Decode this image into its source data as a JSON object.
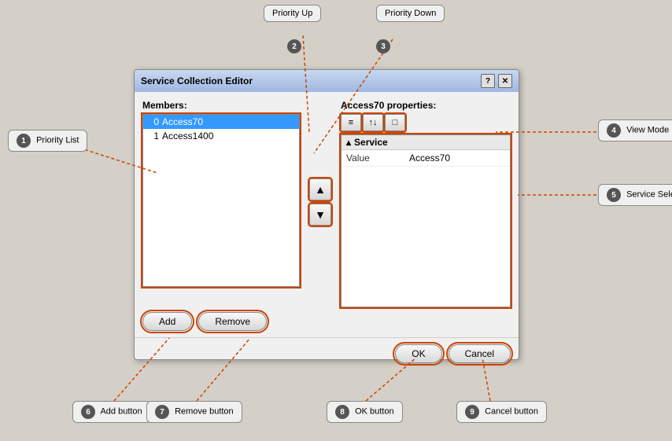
{
  "dialog": {
    "title": "Service Collection Editor",
    "members_label": "Members:",
    "properties_label": "Access70 properties:",
    "members": [
      {
        "index": 0,
        "name": "Access70",
        "selected": true
      },
      {
        "index": 1,
        "name": "Access1400",
        "selected": false
      }
    ],
    "properties": {
      "section": "Service",
      "rows": [
        {
          "name": "Value",
          "value": "Access70"
        }
      ]
    },
    "view_buttons": [
      "≡",
      "↑↓",
      "□"
    ],
    "priority_up_icon": "▲",
    "priority_down_icon": "▼",
    "add_label": "Add",
    "remove_label": "Remove",
    "ok_label": "OK",
    "cancel_label": "Cancel",
    "help_btn": "?",
    "close_btn": "✕"
  },
  "annotations": {
    "priority_list": {
      "number": "1",
      "label": "Priority List"
    },
    "priority_up": {
      "number": "2",
      "label": "Priority Up"
    },
    "priority_down": {
      "number": "3",
      "label": "Priority Down"
    },
    "view_mode": {
      "number": "4",
      "label": "View Mode"
    },
    "service_selector": {
      "number": "5",
      "label": "Service Selector"
    },
    "add_button": {
      "number": "6",
      "label": "Add button"
    },
    "remove_button": {
      "number": "7",
      "label": "Remove button"
    },
    "ok_button": {
      "number": "8",
      "label": "OK button"
    },
    "cancel_button": {
      "number": "9",
      "label": "Cancel button"
    }
  }
}
